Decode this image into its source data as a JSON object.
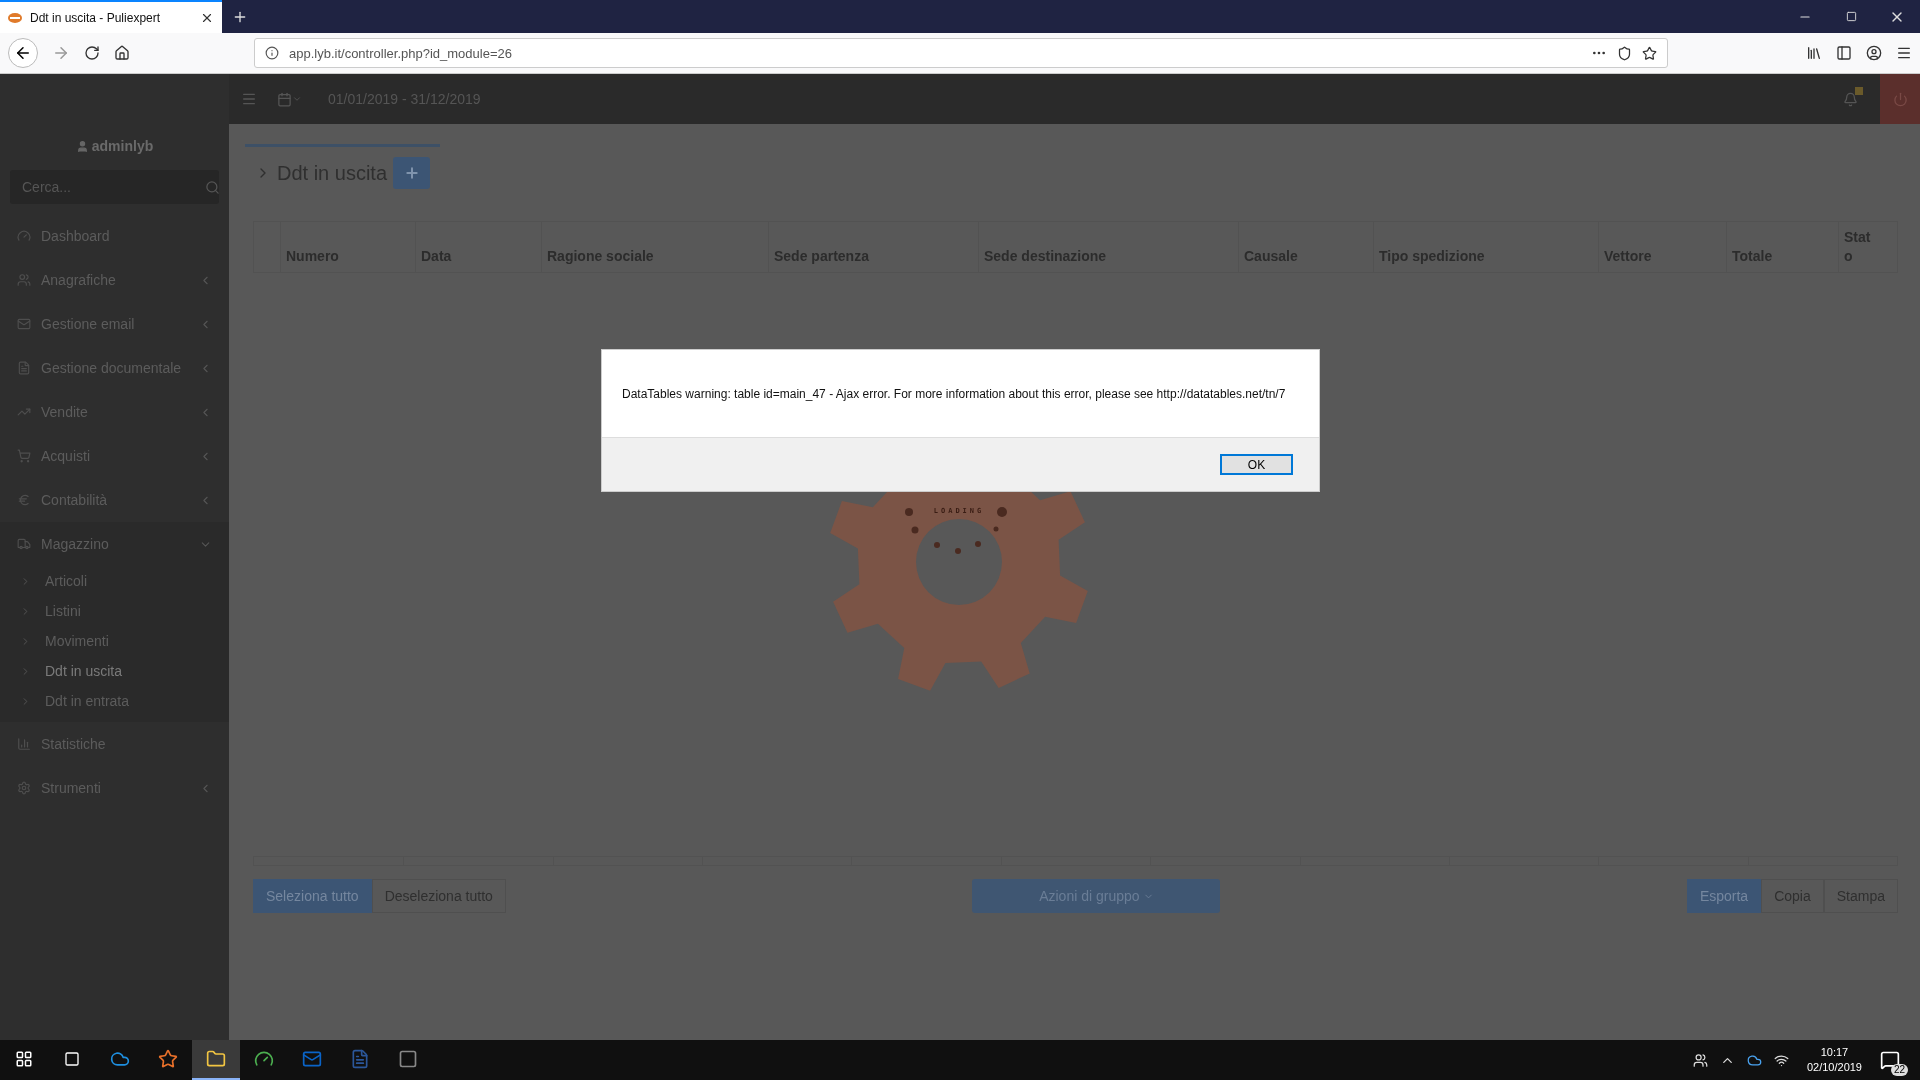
{
  "browser": {
    "tab": {
      "title": "Ddt in uscita - Puliexpert",
      "selected": true
    },
    "url": "app.lyb.it/controller.php?id_module=26"
  },
  "topbar": {
    "date_range": "01/01/2019 - 31/12/2019"
  },
  "sidebar": {
    "user": "adminlyb",
    "search": {
      "placeholder": "Cerca..."
    },
    "items": [
      {
        "label": "Dashboard",
        "submenu": false,
        "expanded": false
      },
      {
        "label": "Anagrafiche",
        "submenu": true,
        "expanded": false
      },
      {
        "label": "Gestione email",
        "submenu": true,
        "expanded": false
      },
      {
        "label": "Gestione documentale",
        "submenu": true,
        "expanded": false
      },
      {
        "label": "Vendite",
        "submenu": true,
        "expanded": false
      },
      {
        "label": "Acquisti",
        "submenu": true,
        "expanded": false
      },
      {
        "label": "Contabilità",
        "submenu": true,
        "expanded": false
      },
      {
        "label": "Magazzino",
        "submenu": true,
        "expanded": true,
        "children": [
          {
            "label": "Articoli",
            "selected": false
          },
          {
            "label": "Listini",
            "selected": false
          },
          {
            "label": "Movimenti",
            "selected": false
          },
          {
            "label": "Ddt in uscita",
            "selected": true
          },
          {
            "label": "Ddt in entrata",
            "selected": false
          }
        ]
      },
      {
        "label": "Statistiche",
        "submenu": false,
        "expanded": false
      },
      {
        "label": "Strumenti",
        "submenu": true,
        "expanded": false
      }
    ]
  },
  "page": {
    "title": "Ddt in uscita"
  },
  "table": {
    "columns": [
      "Numero",
      "Data",
      "Ragione sociale",
      "Sede partenza",
      "Sede destinazione",
      "Causale",
      "Tipo spedizione",
      "Vettore",
      "Totale",
      "Stato"
    ]
  },
  "loading": {
    "label": "LOADING"
  },
  "selection_buttons": [
    {
      "label": "Seleziona tutto",
      "kind": "primary"
    },
    {
      "label": "Deseleziona tutto",
      "kind": "default"
    }
  ],
  "group_actions": {
    "label": "Azioni di gruppo"
  },
  "export_buttons": [
    {
      "label": "Esporta",
      "kind": "primary"
    },
    {
      "label": "Copia",
      "kind": "default"
    },
    {
      "label": "Stampa",
      "kind": "default"
    }
  ],
  "dialog": {
    "message": "DataTables warning: table id=main_47 - Ajax error. For more information about this error, please see http://datatables.net/tn/7",
    "button": "OK"
  },
  "taskbar": {
    "apps": [
      {
        "selected": false
      },
      {
        "selected": false
      },
      {
        "selected": true
      },
      {
        "selected": false
      },
      {
        "selected": false
      },
      {
        "selected": false
      },
      {
        "selected": false
      }
    ],
    "time": "10:17",
    "date": "02/10/2019",
    "notifications": "22"
  }
}
